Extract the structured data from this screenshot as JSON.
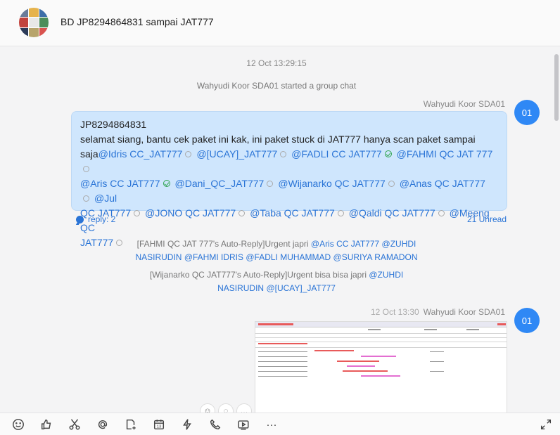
{
  "chat": {
    "title": "BD JP8294864831 sampai JAT777"
  },
  "messages": {
    "date_stamp": "12 Oct 13:29:15",
    "system": "Wahyudi Koor SDA01 started a group chat",
    "first": {
      "sender": "Wahyudi Koor SDA01",
      "avatar": "01",
      "line1": "JP8294864831",
      "line2": "selamat siang, bantu cek paket ini kak, ini paket stuck di JAT777 hanya scan paket sampai",
      "line3_prefix": "saja",
      "mentions": [
        {
          "text": "@Idris CC_JAT777",
          "status": "unread"
        },
        {
          "text": "@[UCAY]_JAT777",
          "status": "unread"
        },
        {
          "text": "@FADLI CC JAT777",
          "status": "read"
        },
        {
          "text": "@FAHMI QC JAT 777",
          "status": "unread"
        },
        {
          "text": "@Aris CC JAT777",
          "status": "read"
        },
        {
          "text": "@Dani_QC_JAT777",
          "status": "unread"
        },
        {
          "text": "@Wijanarko QC JAT777",
          "status": "unread"
        },
        {
          "text": "@Anas QC JAT777",
          "status": "unread"
        },
        {
          "text": "@Jul",
          "status": ""
        },
        {
          "text": "QC JAT777",
          "status": "unread"
        },
        {
          "text": "@JONO QC JAT777",
          "status": "unread"
        },
        {
          "text": "@Taba QC JAT777",
          "status": "unread"
        },
        {
          "text": "@Qaldi QC JAT777",
          "status": "unread"
        },
        {
          "text": "@Meeng QC",
          "status": ""
        },
        {
          "text": "JAT777",
          "status": "unread"
        }
      ],
      "reply": "reply: 2",
      "unread": "21 Unread"
    },
    "auto_reply_1": {
      "prefix": "[FAHMI QC JAT 777's Auto-Reply]Urgent japri ",
      "m1": "@Aris CC JAT777",
      "m2": "@ZUHDI",
      "m3": "NASIRUDIN",
      "m4": "@FAHMI IDRIS",
      "m5": "@FADLI MUHAMMAD",
      "m6": "@SURIYA RAMADON"
    },
    "auto_reply_2": {
      "prefix": "[Wijanarko QC JAT777's Auto-Reply]Urgent bisa bisa japri ",
      "m1": "@ZUHDI",
      "m2": "NASIRUDIN",
      "m3": "@[UCAY]_JAT777"
    },
    "second": {
      "time": "12 Oct 13:30",
      "sender": "Wahyudi Koor SDA01",
      "avatar": "01"
    }
  },
  "toolbar": {
    "icons": [
      "emoji-icon",
      "thumbs-up-icon",
      "scissors-icon",
      "at-icon",
      "file-plus-icon",
      "calendar-icon",
      "flash-icon",
      "phone-icon",
      "video-icon",
      "more-icon",
      "expand-icon"
    ],
    "calendar_day": "13",
    "more": "···"
  },
  "colors": {
    "accent": "#2f88f5",
    "bubble": "#cfe6fd",
    "mention": "#2a74d6"
  }
}
